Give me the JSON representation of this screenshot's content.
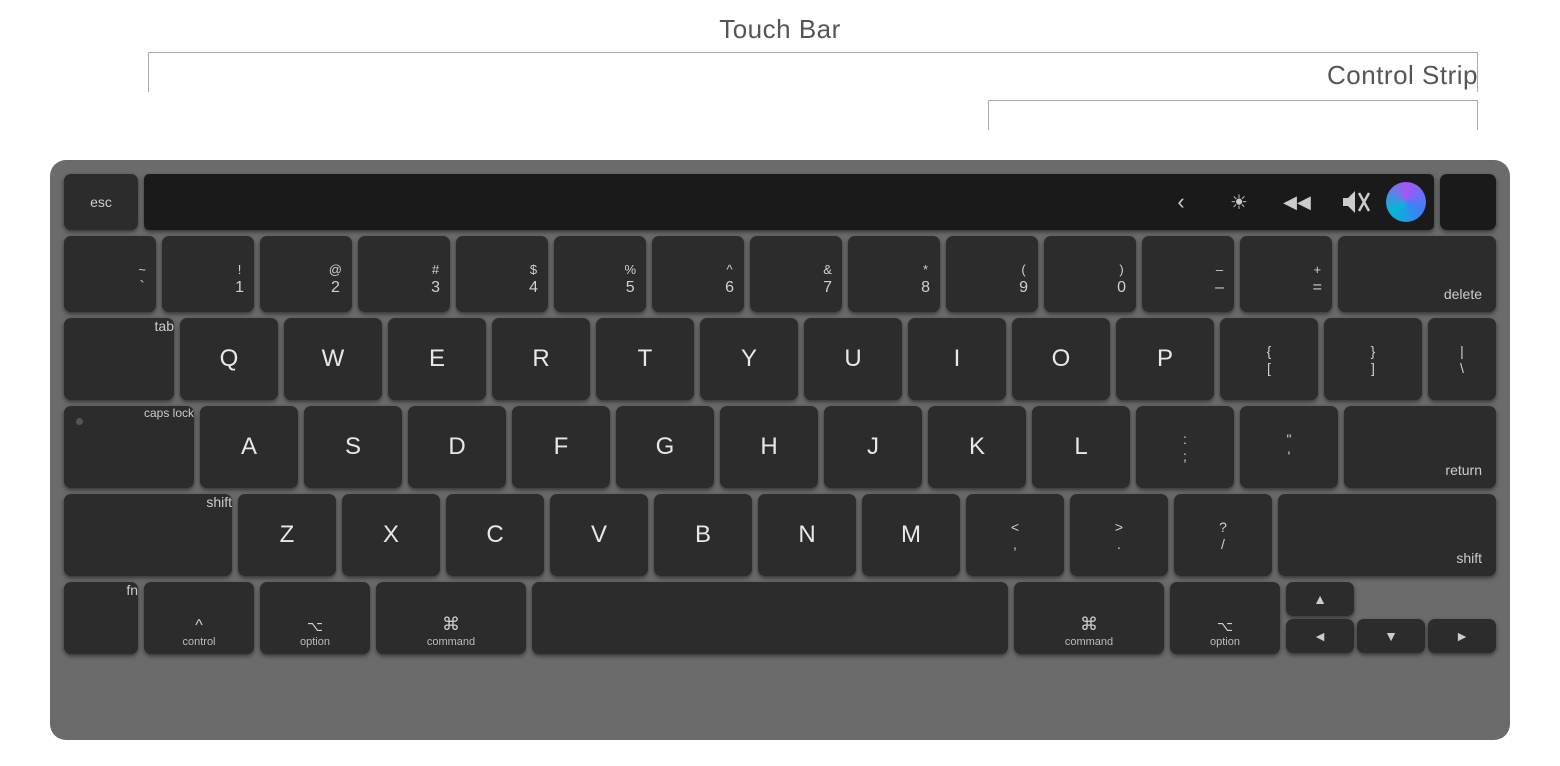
{
  "labels": {
    "touch_bar": "Touch Bar",
    "control_strip": "Control Strip"
  },
  "touchbar": {
    "icons": [
      "‹",
      "☀",
      "◀◀",
      "🔇",
      "⬤"
    ]
  },
  "keyboard": {
    "esc": "esc",
    "delete": "delete",
    "tab": "tab",
    "caps_lock": "caps lock",
    "return": "return",
    "shift": "shift",
    "fn": "fn",
    "control": "control",
    "option": "option",
    "command": "command",
    "number_row": [
      {
        "top": "~",
        "bot": "`"
      },
      {
        "top": "!",
        "bot": "1"
      },
      {
        "top": "@",
        "bot": "2"
      },
      {
        "top": "#",
        "bot": "3"
      },
      {
        "top": "$",
        "bot": "4"
      },
      {
        "top": "%",
        "bot": "5"
      },
      {
        "top": "^",
        "bot": "6"
      },
      {
        "top": "&",
        "bot": "7"
      },
      {
        "top": "*",
        "bot": "8"
      },
      {
        "top": "(",
        "bot": "9"
      },
      {
        "top": ")",
        "bot": "0"
      },
      {
        "top": "—",
        "bot": "–"
      },
      {
        "top": "+",
        "bot": "="
      }
    ],
    "qwerty_row": [
      "Q",
      "W",
      "E",
      "R",
      "T",
      "Y",
      "U",
      "I",
      "O",
      "P"
    ],
    "asdf_row": [
      "A",
      "S",
      "D",
      "F",
      "G",
      "H",
      "J",
      "K",
      "L"
    ],
    "zxcv_row": [
      "Z",
      "X",
      "C",
      "V",
      "B",
      "N",
      "M"
    ],
    "bracket_right": [
      "{",
      "["
    ],
    "brace_right": [
      "}",
      "]"
    ],
    "pipe": [
      "|",
      "\\"
    ],
    "semicolon": [
      ":",
      ";"
    ],
    "quote": [
      "\"",
      "'"
    ],
    "comma": [
      "<",
      ","
    ],
    "period": [
      ">",
      "."
    ],
    "slash": [
      "?",
      "/"
    ],
    "minus": [
      "–",
      "-"
    ],
    "equals": [
      "+",
      "="
    ]
  }
}
